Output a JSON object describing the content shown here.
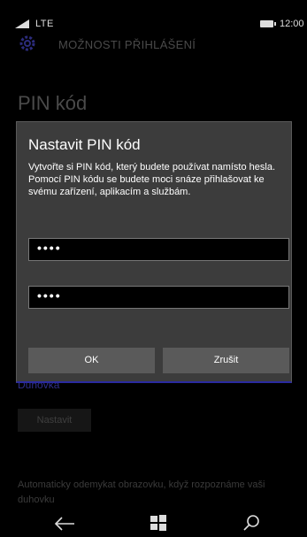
{
  "status": {
    "network": "LTE",
    "time": "12:00"
  },
  "app": {
    "title": "MOŽNOSTI PŘIHLÁŠENÍ",
    "page_heading": "PIN kód",
    "section_label": "Duhovka",
    "setup_button": "Nastavit",
    "auto_unlock_text": "Automaticky odemykat obrazovku, když rozpoznáme vaši duhovku"
  },
  "dialog": {
    "title": "Nastavit PIN kód",
    "description": "Vytvořte si PIN kód, který budete používat namísto hesla. Pomocí PIN kódu se budete moci snáze přihlašovat ke svému zařízení, aplikacím a službám.",
    "pin_value": "••••",
    "pin_confirm_value": "••••",
    "ok_label": "OK",
    "cancel_label": "Zrušit"
  },
  "icons": {
    "settings": "gear-icon",
    "back": "back-arrow-icon",
    "start": "windows-start-icon",
    "search": "search-icon"
  },
  "colors": {
    "accent": "#2a2aa0",
    "dialog_bg": "#3c3c3c",
    "button_bg": "#5a5a5a"
  }
}
